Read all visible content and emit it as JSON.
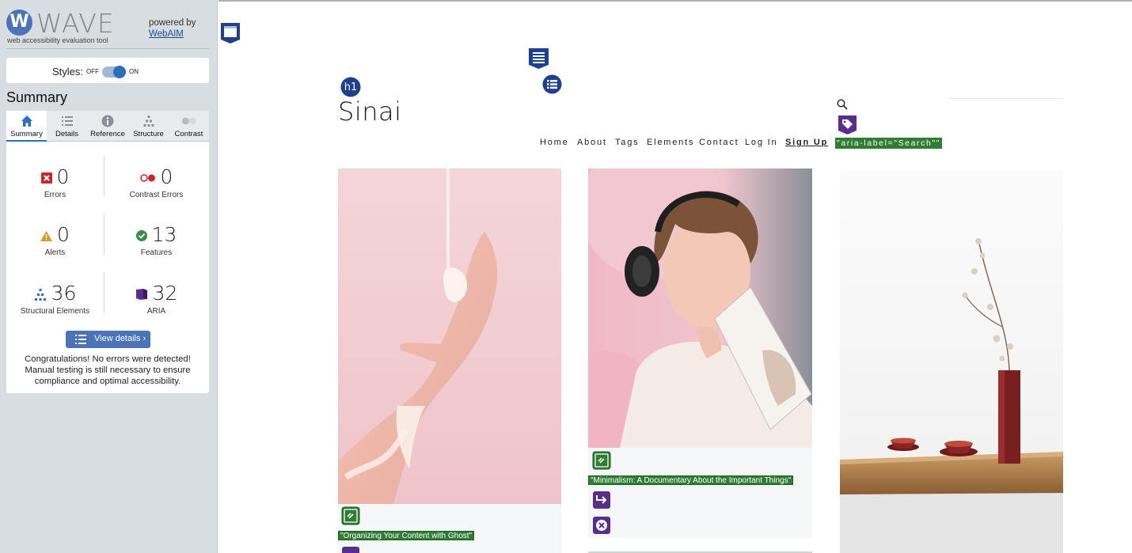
{
  "wave": {
    "logo_letter": "W",
    "logo_text": "WAVE",
    "subtitle": "web accessibility evaluation tool",
    "powered_by": "powered by",
    "powered_link": "WebAIM",
    "styles_label": "Styles:",
    "toggle_off": "OFF",
    "toggle_on": "ON",
    "summary_title": "Summary",
    "tabs": [
      {
        "label": "Summary",
        "icon": "home-icon",
        "active": true
      },
      {
        "label": "Details",
        "icon": "list-icon"
      },
      {
        "label": "Reference",
        "icon": "info-icon"
      },
      {
        "label": "Structure",
        "icon": "hierarchy-icon"
      },
      {
        "label": "Contrast",
        "icon": "contrast-icon"
      }
    ],
    "stats": {
      "errors": {
        "value": "0",
        "label": "Errors"
      },
      "contrast_errors": {
        "value": "0",
        "label": "Contrast Errors"
      },
      "alerts": {
        "value": "0",
        "label": "Alerts"
      },
      "features": {
        "value": "13",
        "label": "Features"
      },
      "structural": {
        "value": "36",
        "label": "Structural Elements"
      },
      "aria": {
        "value": "32",
        "label": "ARIA"
      }
    },
    "view_details": "View details ›",
    "congrats": "Congratulations! No errors were detected! Manual testing is still necessary to ensure compliance and optimal accessibility."
  },
  "site": {
    "title": "Sinai",
    "h1_badge": "h1",
    "nav": [
      "Home",
      "About",
      "Tags",
      "Elements",
      "Contact",
      "Log In",
      "Sign Up"
    ],
    "aria_label_tag": "\"aria-label=\"Search\"\"",
    "card1_link_text": "\"Organizing Your Content with Ghost\"",
    "card2_link_text": "\"Minimalism: A Documentary About the Important Things\""
  },
  "colors": {
    "wave_blue": "#4a74b5",
    "aria_purple": "#5b2d8a",
    "feature_green": "#2e7d32",
    "structure_navy": "#1f3f8f",
    "error_red": "#c62828"
  }
}
